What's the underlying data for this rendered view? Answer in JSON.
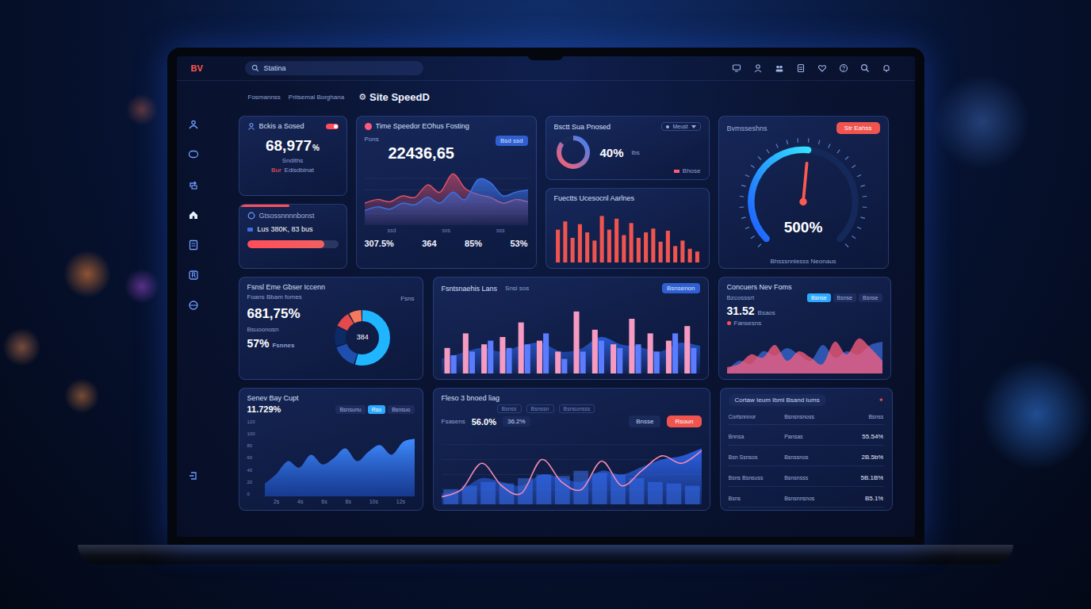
{
  "brand": "BV",
  "search": {
    "value": "Statina"
  },
  "breadcrumb": [
    "Fosmannss",
    "Pritsemal Borghana"
  ],
  "page": {
    "icon": "⚙",
    "title": "Site SpeedD"
  },
  "speed_card": {
    "title": "Bckis a Sosed",
    "value": "68,977",
    "unit": "%",
    "caption": "Sndiths",
    "link_tag": "Bur",
    "link": "Edisdbinat",
    "toggle_on": true
  },
  "load_card": {
    "accent_level": 0.55,
    "title": "Gtsossnnnnbonst",
    "value": "Lus 380K, 83 bus",
    "level": 0.85
  },
  "time_card": {
    "title": "Time Speedor EOhus Fosting",
    "badge": "Bsd ssd",
    "label": "Pons",
    "value": "22436,65",
    "x_ticks": [
      "ssd",
      "sxs",
      "sss"
    ],
    "series": [
      {
        "color": "#e0506a",
        "values": [
          30,
          35,
          32,
          40,
          38,
          55,
          45,
          70,
          50,
          42,
          38,
          30,
          35,
          32
        ]
      },
      {
        "color": "#3b6fe0",
        "values": [
          20,
          25,
          22,
          30,
          28,
          38,
          30,
          45,
          35,
          62,
          58,
          40,
          45,
          48
        ]
      }
    ],
    "stats": [
      "307.5%",
      "364",
      "85%",
      "53%"
    ]
  },
  "ring_card": {
    "title": "Bsctt Sua Pnosed",
    "select": "Meust",
    "value": "40%",
    "unit": "lbs",
    "level": 0.85,
    "legend": "Bhose"
  },
  "bars_card": {
    "title": "Fuectts Ucesocnl Aarlnes",
    "values": [
      60,
      75,
      45,
      70,
      55,
      40,
      85,
      60,
      80,
      50,
      72,
      45,
      55,
      62,
      38,
      58,
      30,
      40,
      25,
      20
    ]
  },
  "gauge_card": {
    "title": "Bvmsseshns",
    "button": "Str Eahss",
    "value": "500%",
    "caption": "Bhsssnnlesss Neonaus",
    "level": 0.52
  },
  "mix_card": {
    "title": "Fsnsl Eme Gbser Iccenn",
    "subtitle": "Foans Bbam fomes",
    "value": "681,75%",
    "caption": "Bsuoonosn",
    "value2": "57%",
    "caption2": "Fsnnes",
    "center": "384",
    "legend": "Fsns",
    "segments": [
      {
        "share": 0.55,
        "color": "#1fb6ff"
      },
      {
        "share": 0.15,
        "color": "#1e4fae"
      },
      {
        "share": 0.12,
        "color": "#0b2a66"
      },
      {
        "share": 0.1,
        "color": "#e5484d"
      },
      {
        "share": 0.08,
        "color": "#f47a5b"
      }
    ]
  },
  "trend_card": {
    "title": "Fsntsnaehis Lans",
    "note": "Snsl sos",
    "button": "Bsnsenon",
    "pink": [
      35,
      55,
      40,
      50,
      70,
      45,
      30,
      85,
      60,
      40,
      75,
      55,
      45,
      65
    ],
    "blue": [
      25,
      30,
      45,
      35,
      40,
      55,
      20,
      30,
      45,
      35,
      40,
      30,
      55,
      35
    ],
    "area": [
      20,
      28,
      35,
      30,
      38,
      42,
      30,
      34,
      50,
      40,
      36,
      30,
      42,
      38
    ]
  },
  "visits_card": {
    "title": "Concuers Nev Foms",
    "subtitle": "Bzcosssrt",
    "value": "31.52",
    "unit": "Bsaos",
    "pills": [
      {
        "label": "Bsnse",
        "selected": true
      },
      {
        "label": "Bsnse",
        "selected": false
      },
      {
        "label": "Bsnse",
        "selected": false
      }
    ],
    "legend": "Fansesns",
    "series": [
      {
        "color": "#3b6fe0",
        "values": [
          5,
          20,
          15,
          35,
          28,
          40,
          30,
          20,
          45,
          25,
          35,
          30,
          45,
          50
        ]
      },
      {
        "color": "#ff5f7e",
        "values": [
          10,
          15,
          30,
          25,
          45,
          20,
          35,
          25,
          15,
          50,
          30,
          55,
          40,
          20
        ]
      }
    ]
  },
  "daily_card": {
    "title": "Senev Bay Cupt",
    "value": "11.729%",
    "pills": [
      {
        "label": "Bsnsunu",
        "selected": false
      },
      {
        "label": "Rso",
        "selected": true
      },
      {
        "label": "Bsnsuo",
        "selected": false
      }
    ],
    "y_ticks": [
      "120",
      "100",
      "80",
      "60",
      "40",
      "20",
      "0"
    ],
    "x_ticks": [
      "2s",
      "4s",
      "6s",
      "8s",
      "10s",
      "12s"
    ],
    "values": [
      20,
      35,
      55,
      45,
      65,
      50,
      60,
      75,
      55,
      70,
      80,
      65,
      85,
      90
    ]
  },
  "flow_card": {
    "title": "Fleso 3 bnoed liag",
    "filters": [
      "Bsnss",
      "Bsnssn",
      "Bsnsunsss"
    ],
    "label": "Fsasens",
    "value": "56.0%",
    "chip": "36.2%",
    "buttons": [
      {
        "label": "Bnsse",
        "kind": "ghost"
      },
      {
        "label": "Rsoun",
        "kind": "primary"
      }
    ],
    "line": [
      10,
      20,
      55,
      25,
      15,
      60,
      30,
      20,
      58,
      25,
      45,
      65,
      55,
      72
    ],
    "area": [
      15,
      20,
      35,
      30,
      25,
      40,
      35,
      30,
      45,
      40,
      50,
      60,
      65,
      75
    ],
    "bars": [
      20,
      25,
      30,
      28,
      35,
      40,
      38,
      45,
      42,
      40,
      35,
      30,
      28,
      25
    ]
  },
  "table_card": {
    "title": "Cortaw Ieum Ibml Bsand Iums",
    "badge": "✦",
    "columns": [
      "Cortsnnnor",
      "Bsnsnsnoss",
      "Bsnss"
    ],
    "rows": [
      [
        "Bnnsa",
        "Pansas",
        "55.54%"
      ],
      [
        "Bsn Ssnsos",
        "Bsnssnos",
        "2B.5b%"
      ],
      [
        "Bsns Bsnsuss",
        "Bsnsnsss",
        "5B.1B%"
      ],
      [
        "Bsns",
        "Bsnsnnsnos",
        "B5.1%"
      ]
    ]
  }
}
